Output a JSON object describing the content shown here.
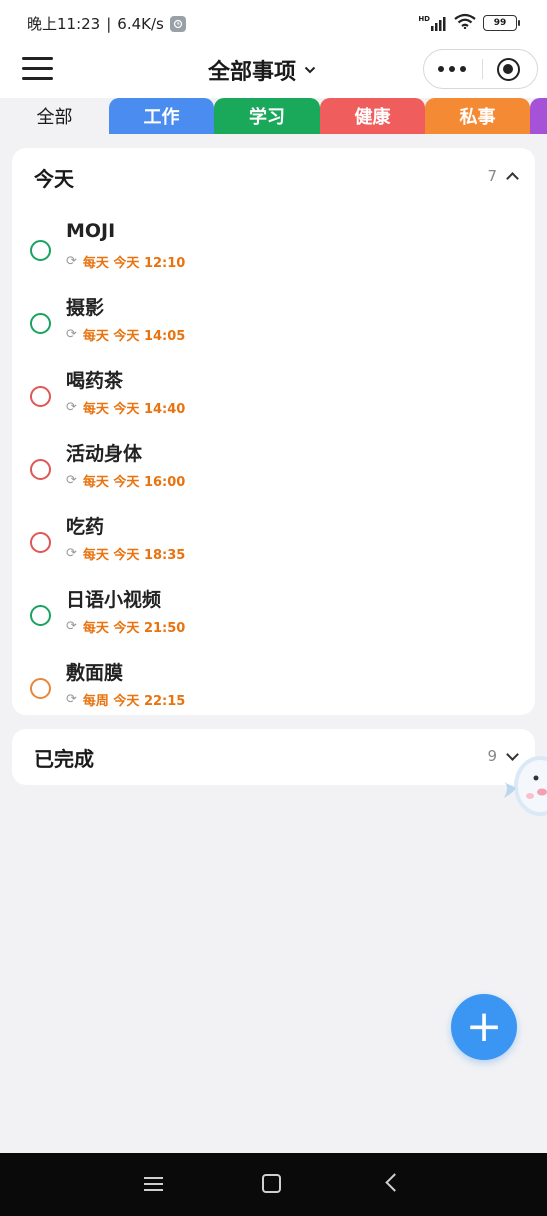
{
  "status_bar": {
    "time": "晚上11:23",
    "separator": "|",
    "net_speed": "6.4K/s",
    "signal_label": "HD",
    "battery": "99"
  },
  "header": {
    "title": "全部事项"
  },
  "tabs": [
    {
      "label": "全部",
      "color": "#f2f2f4",
      "active": true
    },
    {
      "label": "工作",
      "color": "#4a8cf0"
    },
    {
      "label": "学习",
      "color": "#1aa85a"
    },
    {
      "label": "健康",
      "color": "#f05d5d"
    },
    {
      "label": "私事",
      "color": "#f58a35"
    },
    {
      "label": "",
      "color": "#a552d8"
    }
  ],
  "today": {
    "title": "今天",
    "count": "7",
    "tasks": [
      {
        "name": "MOJI",
        "meta": "每天 今天 12:10",
        "circle_color": "#1aa260"
      },
      {
        "name": "摄影",
        "meta": "每天 今天 14:05",
        "circle_color": "#1aa260"
      },
      {
        "name": "喝药茶",
        "meta": "每天 今天 14:40",
        "circle_color": "#e05555"
      },
      {
        "name": "活动身体",
        "meta": "每天 今天 16:00",
        "circle_color": "#e05555"
      },
      {
        "name": "吃药",
        "meta": "每天 今天 18:35",
        "circle_color": "#e05555"
      },
      {
        "name": "日语小视频",
        "meta": "每天 今天 21:50",
        "circle_color": "#1aa260"
      },
      {
        "name": "敷面膜",
        "meta": "每周 今天 22:15",
        "circle_color": "#e8873a"
      }
    ]
  },
  "completed": {
    "title": "已完成",
    "count": "9"
  },
  "fab": {
    "label": "+"
  },
  "icons": {
    "menu": "hamburger-icon",
    "more": "more-dots-icon",
    "target": "target-icon",
    "repeat": "repeat-icon",
    "add": "plus-icon"
  }
}
